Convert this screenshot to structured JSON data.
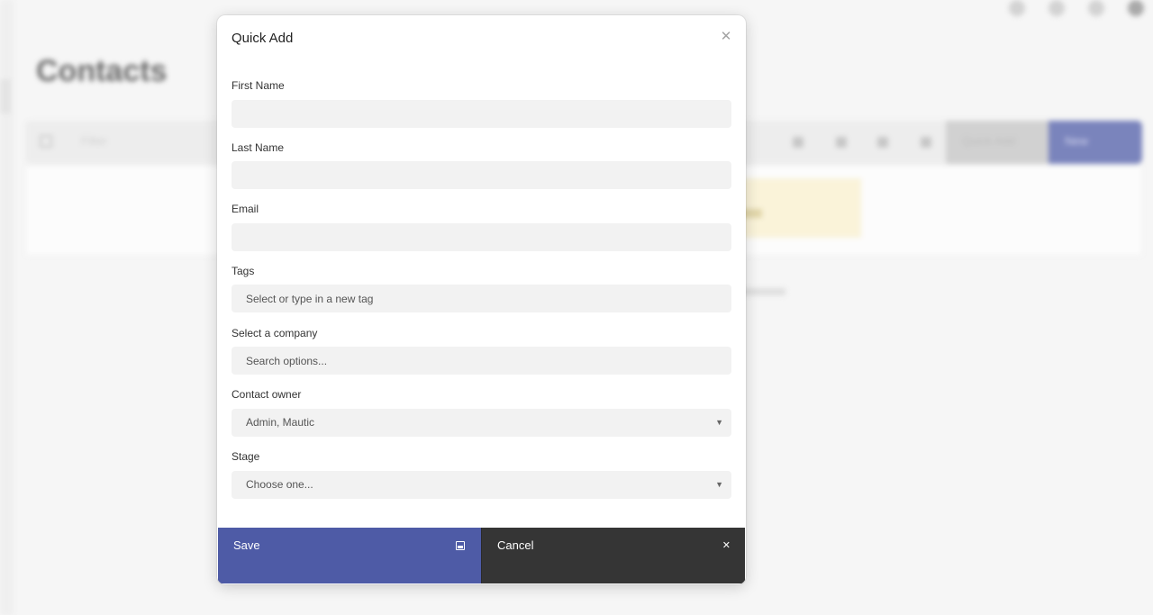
{
  "background": {
    "page_title": "Contacts",
    "filter_placeholder": "Filter",
    "quick_add_label": "Quick Add",
    "new_label": "New"
  },
  "modal": {
    "title": "Quick Add",
    "close_icon": "close-icon",
    "fields": {
      "first_name": {
        "label": "First Name",
        "value": ""
      },
      "last_name": {
        "label": "Last Name",
        "value": ""
      },
      "email": {
        "label": "Email",
        "value": ""
      },
      "tags": {
        "label": "Tags",
        "placeholder": "Select or type in a new tag"
      },
      "company": {
        "label": "Select a company",
        "placeholder": "Search options..."
      },
      "owner": {
        "label": "Contact owner",
        "value": "Admin, Mautic"
      },
      "stage": {
        "label": "Stage",
        "value": "Choose one..."
      }
    },
    "footer": {
      "save_label": "Save",
      "save_icon": "save-icon",
      "cancel_label": "Cancel",
      "cancel_icon": "close-icon"
    }
  },
  "colors": {
    "primary": "#4e5ba6",
    "dark_button": "#353535",
    "input_bg": "#f2f2f2"
  }
}
